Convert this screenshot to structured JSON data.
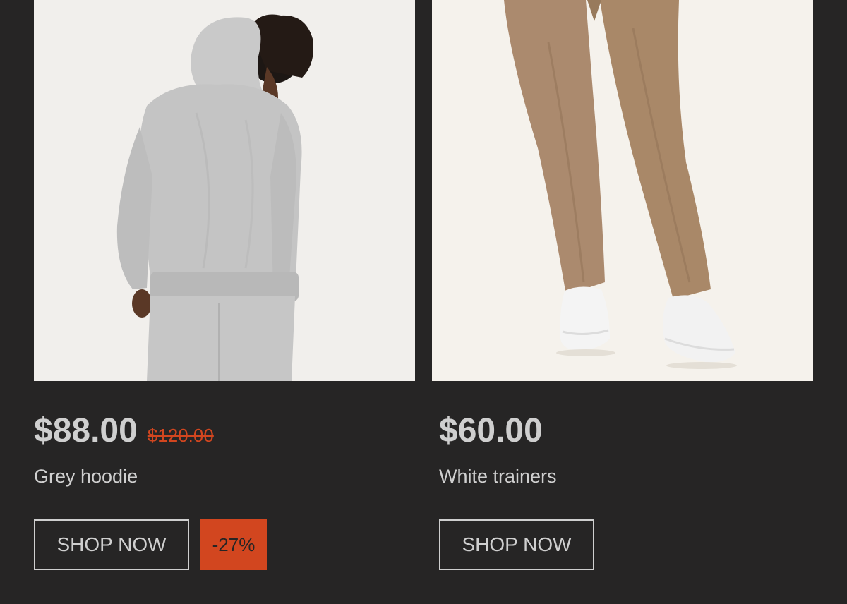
{
  "colors": {
    "background": "#262525",
    "text": "#cfcfcf",
    "sale_accent": "#d2461f"
  },
  "products": [
    {
      "image_alt": "Grey hoodie",
      "price": "$88.00",
      "compare_price": "$120.00",
      "title": "Grey hoodie",
      "button_label": "SHOP NOW",
      "discount_badge": "-27%"
    },
    {
      "image_alt": "White trainers",
      "price": "$60.00",
      "title": "White trainers",
      "button_label": "SHOP NOW"
    }
  ]
}
